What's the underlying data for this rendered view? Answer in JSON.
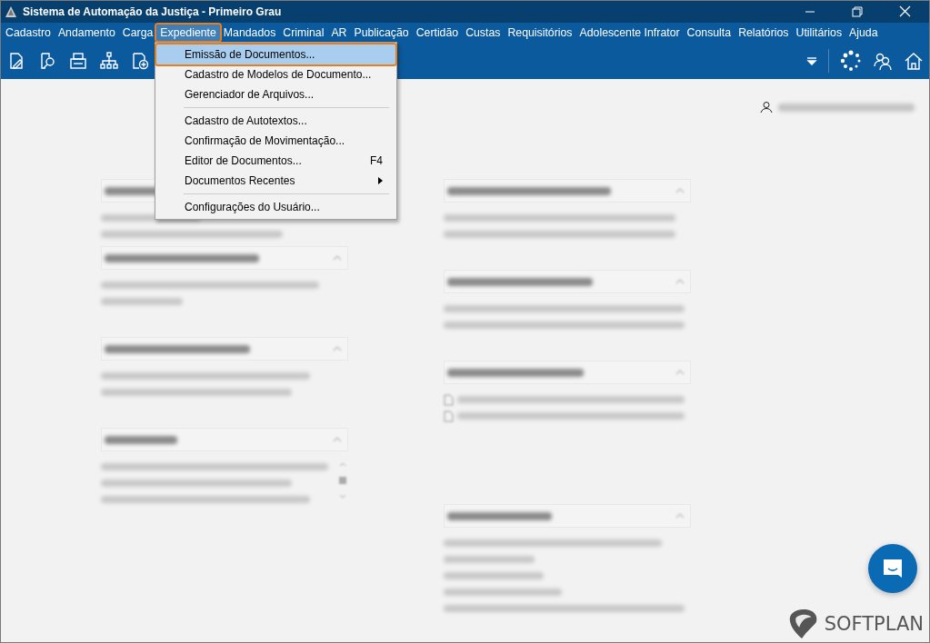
{
  "window": {
    "title": "Sistema de Automação da Justiça - Primeiro Grau"
  },
  "menu_bar": [
    {
      "label": "Cadastro",
      "selected": false
    },
    {
      "label": "Andamento",
      "selected": false
    },
    {
      "label": "Carga",
      "selected": false
    },
    {
      "label": "Expediente",
      "selected": true
    },
    {
      "label": "Mandados",
      "selected": false
    },
    {
      "label": "Criminal",
      "selected": false
    },
    {
      "label": "AR",
      "selected": false
    },
    {
      "label": "Publicação",
      "selected": false
    },
    {
      "label": "Certidão",
      "selected": false
    },
    {
      "label": "Custas",
      "selected": false
    },
    {
      "label": "Requisitórios",
      "selected": false
    },
    {
      "label": "Adolescente Infrator",
      "selected": false
    },
    {
      "label": "Consulta",
      "selected": false
    },
    {
      "label": "Relatórios",
      "selected": false
    },
    {
      "label": "Utilitários",
      "selected": false
    },
    {
      "label": "Ajuda",
      "selected": false
    }
  ],
  "dropdown": [
    {
      "kind": "item",
      "label": "Emissão de Documentos...",
      "selected": true
    },
    {
      "kind": "item",
      "label": "Cadastro de Modelos de Documento...",
      "selected": false
    },
    {
      "kind": "item",
      "label": "Gerenciador de Arquivos...",
      "selected": false
    },
    {
      "kind": "separator"
    },
    {
      "kind": "item",
      "label": "Cadastro de Autotextos...",
      "selected": false
    },
    {
      "kind": "item",
      "label": "Confirmação de Movimentação...",
      "selected": false
    },
    {
      "kind": "item",
      "label": "Editor de Documentos...",
      "shortcut": "F4",
      "selected": false
    },
    {
      "kind": "submenu",
      "label": "Documentos Recentes",
      "selected": false
    },
    {
      "kind": "separator"
    },
    {
      "kind": "item",
      "label": "Configurações do Usuário...",
      "selected": false
    }
  ],
  "logo": {
    "text": "SOFTPLAN"
  }
}
